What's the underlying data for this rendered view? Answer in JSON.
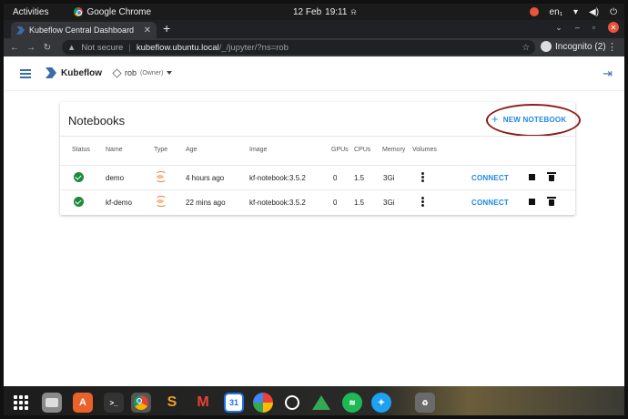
{
  "system_bar": {
    "activities": "Activities",
    "app_name": "Google Chrome",
    "date": "12 Feb",
    "time": "19:11",
    "lang": "en₁"
  },
  "browser": {
    "tab_title": "Kubeflow Central Dashboard",
    "security_label": "Not secure",
    "url_host": "kubeflow.ubuntu.local",
    "url_path": "/_/jupyter/?ns=rob",
    "profile_label": "Incognito (2)"
  },
  "kubeflow": {
    "brand": "Kubeflow",
    "namespace": "rob",
    "namespace_role": "(Owner)"
  },
  "notebooks": {
    "title": "Notebooks",
    "new_button": "NEW NOTEBOOK",
    "columns": [
      "Status",
      "Name",
      "Type",
      "Age",
      "Image",
      "GPUs",
      "CPUs",
      "Memory",
      "Volumes"
    ],
    "rows": [
      {
        "name": "demo",
        "age": "4 hours ago",
        "image": "kf-notebook:3.5.2",
        "gpus": "0",
        "cpus": "1.5",
        "memory": "3Gi",
        "action": "CONNECT"
      },
      {
        "name": "kf-demo",
        "age": "22 mins ago",
        "image": "kf-notebook:3.5.2",
        "gpus": "0",
        "cpus": "1.5",
        "memory": "3Gi",
        "action": "CONNECT"
      }
    ]
  },
  "dock": {
    "apps": [
      "show-apps",
      "files",
      "software",
      "terminal",
      "chrome",
      "sublime-text",
      "gmail",
      "calendar",
      "photos",
      "circle-app",
      "drive",
      "spotify",
      "twitter",
      "trash"
    ],
    "calendar_day": "31"
  }
}
